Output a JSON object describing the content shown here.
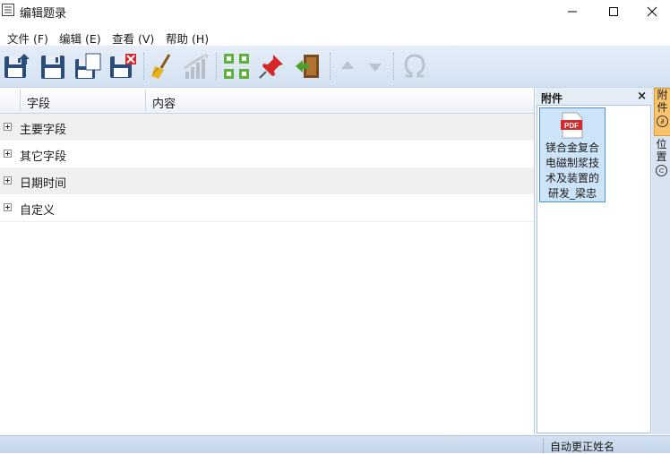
{
  "window": {
    "title": "编辑题录"
  },
  "menu": [
    "文件 (F)",
    "编辑 (E)",
    "查看 (V)",
    "帮助 (H)"
  ],
  "toolbar": {
    "icons": [
      "save-as-icon",
      "save-icon",
      "save-copy-icon",
      "save-close-icon",
      "clean-icon",
      "chart-icon",
      "arrange-icon",
      "pin-icon",
      "exit-icon",
      "move-up-icon",
      "move-down-icon",
      "omega-icon"
    ]
  },
  "grid": {
    "columns": [
      "字段",
      "内容"
    ],
    "rows": [
      "主要字段",
      "其它字段",
      "日期时间",
      "自定义"
    ]
  },
  "attachments": {
    "title": "附件",
    "close": "×",
    "items": [
      {
        "type_label": "PDF",
        "name": "镁合金复合电磁制浆技术及装置的研发_梁忠"
      }
    ]
  },
  "sidetabs": [
    {
      "label": "附件"
    },
    {
      "label": "位置"
    }
  ],
  "status": {
    "text": "自动更正姓名"
  },
  "colors": {
    "toolbar_bg": "#d3e1f1",
    "selection": "#cde3f7",
    "active_tab": "#f7c36b"
  }
}
